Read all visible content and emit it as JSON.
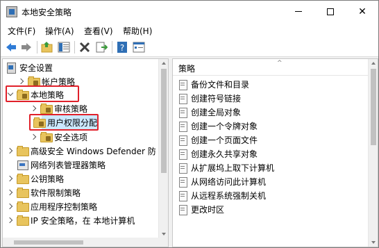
{
  "window": {
    "title": "本地安全策略",
    "controls": {
      "minimize": "—",
      "maximize": "☐",
      "close": "✕"
    }
  },
  "menu": [
    "文件(F)",
    "操作(A)",
    "查看(V)",
    "帮助(H)"
  ],
  "toolbar": {
    "buttons": [
      "back-arrow-icon",
      "forward-arrow-icon",
      "up-folder-icon",
      "show-hide-tree-icon",
      "delete-icon",
      "export-list-icon",
      "help-icon",
      "properties-icon"
    ]
  },
  "tree": {
    "root": "安全设置",
    "items": [
      {
        "label": "帐户策略",
        "level": 1,
        "expanded": false
      },
      {
        "label": "本地策略",
        "level": 1,
        "expanded": true,
        "highlighted": true
      },
      {
        "label": "审核策略",
        "level": 2,
        "expanded": false
      },
      {
        "label": "用户权限分配",
        "level": 2,
        "selected": true,
        "highlighted": true
      },
      {
        "label": "安全选项",
        "level": 2,
        "expanded": false
      },
      {
        "label": "高级安全 Windows Defender 防",
        "level": 1,
        "expanded": false
      },
      {
        "label": "网络列表管理器策略",
        "level": 1
      },
      {
        "label": "公钥策略",
        "level": 1,
        "expanded": false
      },
      {
        "label": "软件限制策略",
        "level": 1,
        "expanded": false
      },
      {
        "label": "应用程序控制策略",
        "level": 1,
        "expanded": false
      },
      {
        "label": "IP 安全策略，在 本地计算机",
        "level": 1,
        "expanded": false
      }
    ]
  },
  "list": {
    "column_header": "策略",
    "items": [
      "备份文件和目录",
      "创建符号链接",
      "创建全局对象",
      "创建一个令牌对象",
      "创建一个页面文件",
      "创建永久共享对象",
      "从扩展坞上取下计算机",
      "从网络访问此计算机",
      "从远程系统强制关机",
      "更改时区"
    ]
  },
  "colors": {
    "highlight_border": "#e0202a",
    "selection_fill": "#cce8ff",
    "folder": "#e8c45d"
  }
}
